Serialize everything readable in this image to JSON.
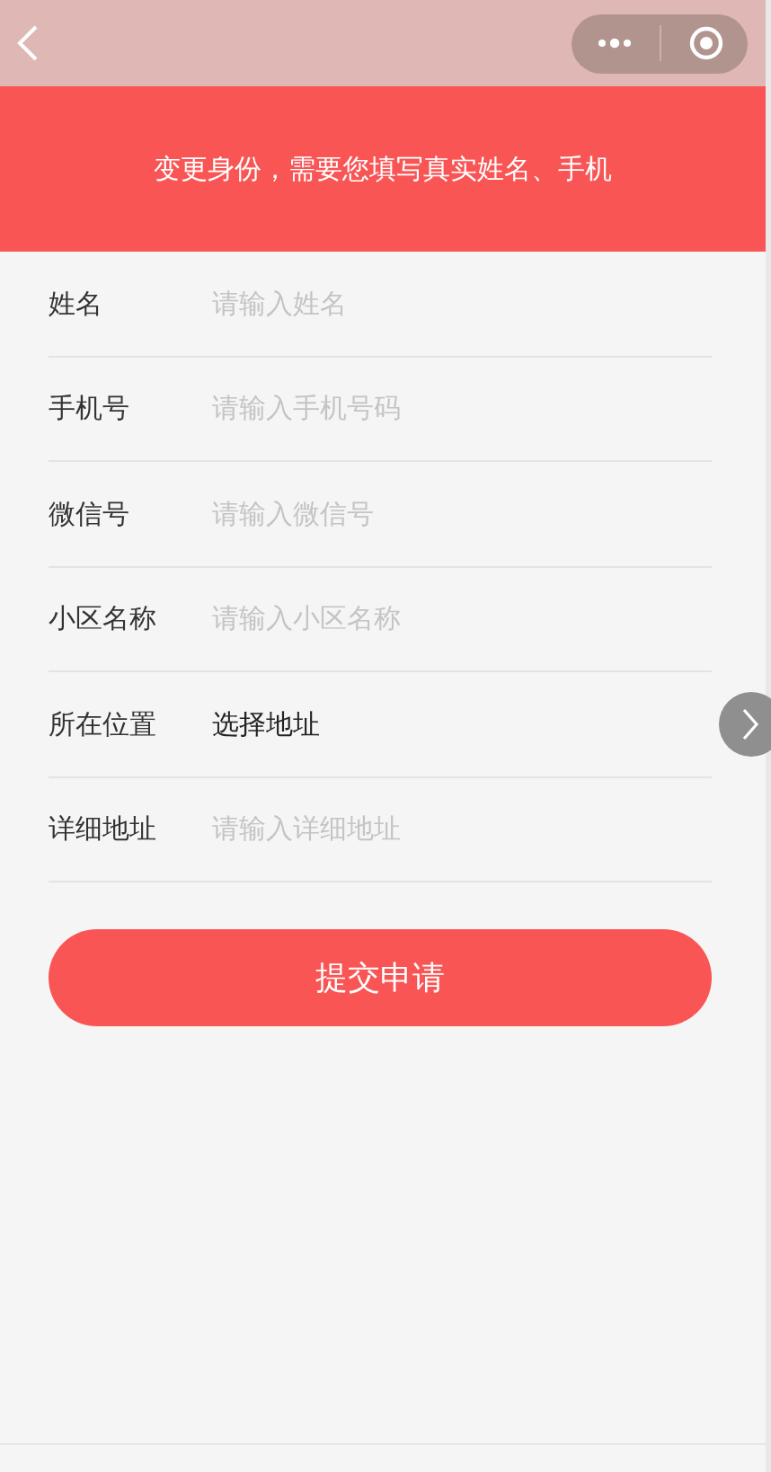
{
  "banner": {
    "text": "变更身份，需要您填写真实姓名、手机"
  },
  "fields": [
    {
      "kind": "input",
      "label": "姓名",
      "placeholder": "请输入姓名"
    },
    {
      "kind": "input",
      "label": "手机号",
      "placeholder": "请输入手机号码"
    },
    {
      "kind": "input",
      "label": "微信号",
      "placeholder": "请输入微信号"
    },
    {
      "kind": "input",
      "label": "小区名称",
      "placeholder": "请输入小区名称"
    },
    {
      "kind": "select",
      "label": "所在位置",
      "value": "选择地址"
    },
    {
      "kind": "input",
      "label": "详细地址",
      "placeholder": "请输入详细地址"
    }
  ],
  "submit": {
    "label": "提交申请"
  }
}
